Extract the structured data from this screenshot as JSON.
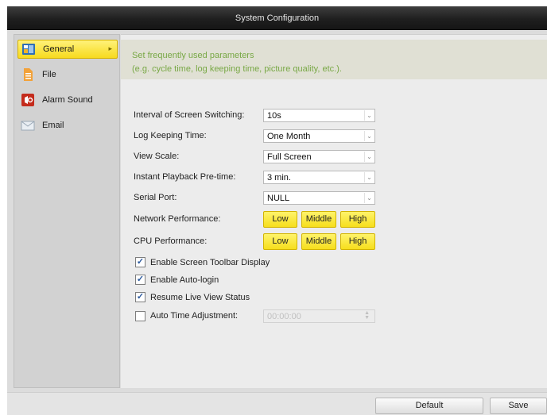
{
  "window": {
    "title": "System Configuration"
  },
  "sidebar": {
    "items": [
      {
        "label": "General",
        "icon": "general-settings-icon",
        "active": true
      },
      {
        "label": "File",
        "icon": "file-icon",
        "active": false
      },
      {
        "label": "Alarm Sound",
        "icon": "alarm-sound-icon",
        "active": false
      },
      {
        "label": "Email",
        "icon": "email-icon",
        "active": false
      }
    ]
  },
  "info": {
    "line1": "Set frequently used parameters",
    "line2": "(e.g. cycle time, log keeping time, picture quality, etc.)."
  },
  "settings": {
    "interval_label": "Interval of Screen Switching:",
    "interval_value": "10s",
    "log_label": "Log Keeping Time:",
    "log_value": "One Month",
    "view_scale_label": "View Scale:",
    "view_scale_value": "Full Screen",
    "playback_label": "Instant Playback Pre-time:",
    "playback_value": "3 min.",
    "serial_label": "Serial Port:",
    "serial_value": "NULL",
    "network_label": "Network Performance:",
    "cpu_label": "CPU Performance:",
    "perf_low": "Low",
    "perf_middle": "Middle",
    "perf_high": "High"
  },
  "options": {
    "toolbar_label": "Enable Screen Toolbar Display",
    "toolbar_checked": true,
    "autologin_label": "Enable Auto-login",
    "autologin_checked": true,
    "resume_label": "Resume Live View Status",
    "resume_checked": true,
    "autotime_label": "Auto Time Adjustment:",
    "autotime_checked": false,
    "autotime_value": "00:00:00"
  },
  "footer": {
    "default_label": "Default",
    "save_label": "Save"
  },
  "colors": {
    "accent_yellow": "#f6de1d",
    "info_green": "#78a845",
    "titlebar": "#1f1f1f"
  }
}
